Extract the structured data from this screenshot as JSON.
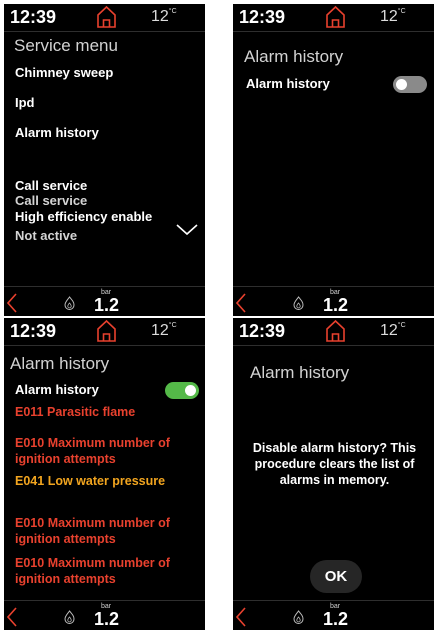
{
  "status": {
    "time": "12:39",
    "temperature": "12",
    "temp_unit": "°C"
  },
  "footer": {
    "pressure_unit": "bar",
    "pressure": "1.2"
  },
  "icons": {
    "home": "home-icon",
    "back": "back-chevron-icon",
    "flame": "flame-icon",
    "expand": "chevron-down-icon"
  },
  "colors": {
    "accent": "#e8412e",
    "warning": "#f2a51f",
    "toggle_on": "#54b948",
    "toggle_off": "#8a8a8a"
  },
  "service_menu": {
    "title": "Service menu",
    "items": [
      "Chimney sweep",
      "Ipd",
      "Alarm history"
    ],
    "call_service": {
      "label": "Call service",
      "value": "Call service"
    },
    "high_efficiency": {
      "label": "High efficiency enable",
      "value": "Not active"
    }
  },
  "alarm_history_off": {
    "title": "Alarm history",
    "toggle_label": "Alarm history",
    "toggle_state": "off"
  },
  "alarm_history_on": {
    "title": "Alarm history",
    "toggle_label": "Alarm history",
    "toggle_state": "on",
    "alarms": [
      {
        "code": "E011",
        "text": "Parasitic flame"
      },
      {
        "code": "E010",
        "text": "Maximum number of ignition attempts"
      },
      {
        "code": "E041",
        "text": "Low water pressure"
      },
      {
        "code": "E010",
        "text": "Maximum number of ignition attempts"
      },
      {
        "code": "E010",
        "text": "Maximum number of ignition attempts"
      }
    ]
  },
  "disable_dialog": {
    "title": "Alarm history",
    "message": "Disable alarm history? This procedure clears the list of alarms in memory.",
    "ok_label": "OK"
  }
}
